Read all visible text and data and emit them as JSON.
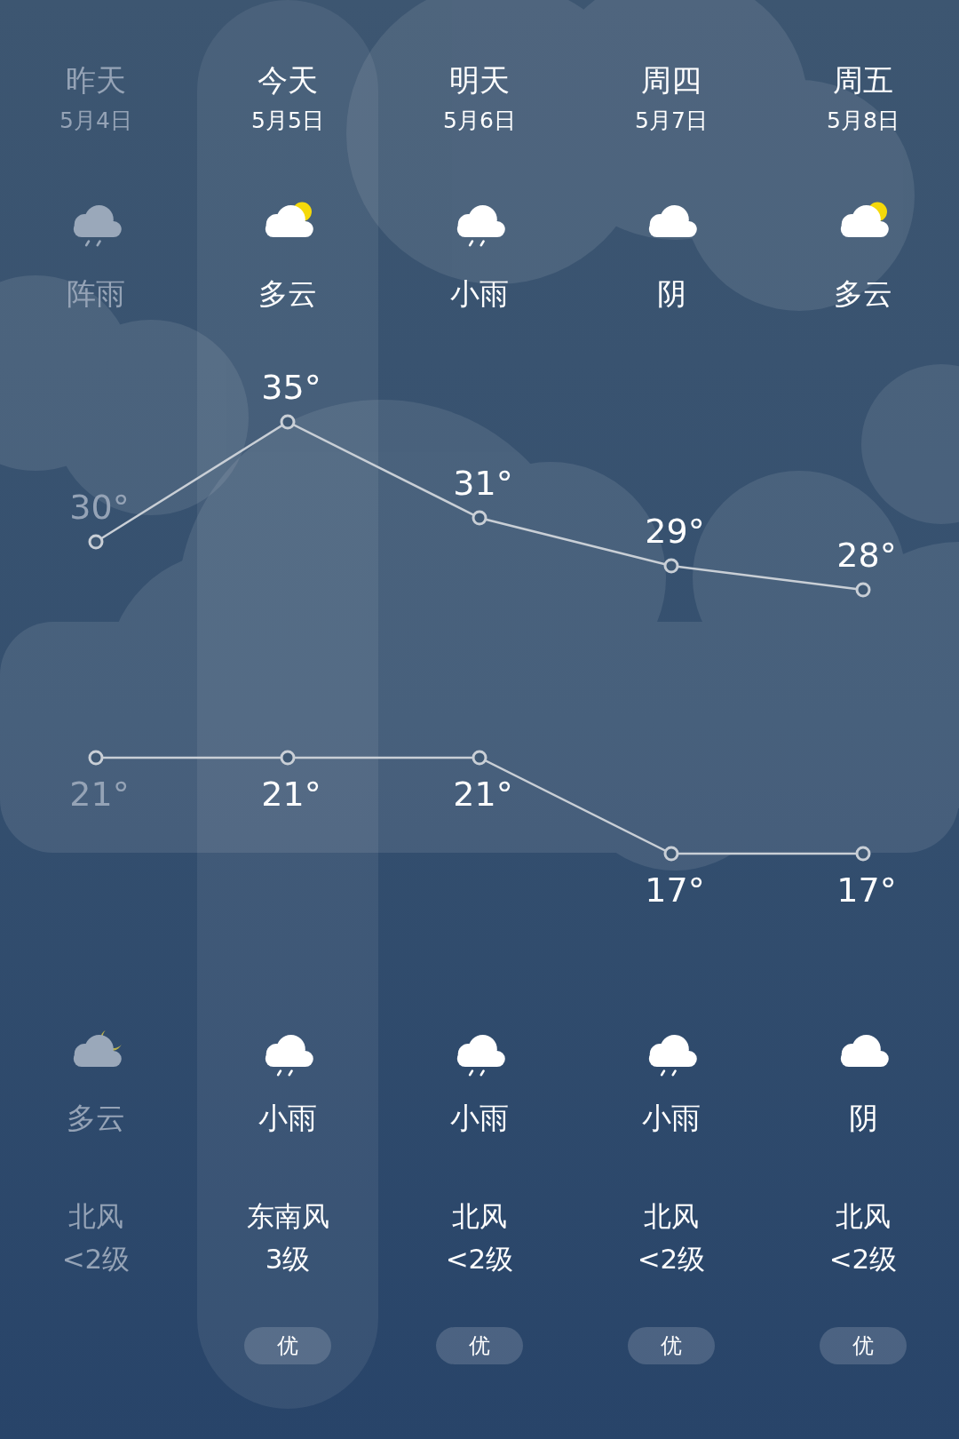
{
  "days": [
    {
      "label": "昨天",
      "date": "5月4日",
      "selected": false,
      "past": true,
      "day": {
        "kind": "rain",
        "text": "阵雨"
      },
      "night": {
        "kind": "partly_cloudy_night",
        "text": "多云"
      },
      "wind": "北风",
      "wind_level": "<2级"
    },
    {
      "label": "今天",
      "date": "5月5日",
      "selected": true,
      "past": false,
      "day": {
        "kind": "partly_cloudy",
        "text": "多云"
      },
      "night": {
        "kind": "rain",
        "text": "小雨"
      },
      "wind": "东南风",
      "wind_level": "3级",
      "aqi": "优"
    },
    {
      "label": "明天",
      "date": "5月6日",
      "selected": false,
      "past": false,
      "day": {
        "kind": "rain",
        "text": "小雨"
      },
      "night": {
        "kind": "rain",
        "text": "小雨"
      },
      "wind": "北风",
      "wind_level": "<2级",
      "aqi": "优"
    },
    {
      "label": "周四",
      "date": "5月7日",
      "selected": false,
      "past": false,
      "day": {
        "kind": "cloudy",
        "text": "阴"
      },
      "night": {
        "kind": "rain",
        "text": "小雨"
      },
      "wind": "北风",
      "wind_level": "<2级",
      "aqi": "优"
    },
    {
      "label": "周五",
      "date": "5月8日",
      "selected": false,
      "past": false,
      "day": {
        "kind": "partly_cloudy",
        "text": "多云"
      },
      "night": {
        "kind": "cloudy",
        "text": "阴"
      },
      "wind": "北风",
      "wind_level": "<2级",
      "aqi": "优"
    }
  ],
  "chart_data": {
    "type": "line",
    "series": [
      {
        "color": "#c9cfd6",
        "marker": "o",
        "values": [
          30,
          35,
          31,
          29,
          28
        ],
        "value_labels": [
          "30°",
          "35°",
          "31°",
          "29°",
          "28°"
        ]
      },
      {
        "color": "#c9cfd6",
        "marker": "o",
        "values": [
          21,
          21,
          21,
          17,
          17
        ],
        "value_labels": [
          "21°",
          "21°",
          "21°",
          "17°",
          "17°"
        ]
      }
    ]
  }
}
